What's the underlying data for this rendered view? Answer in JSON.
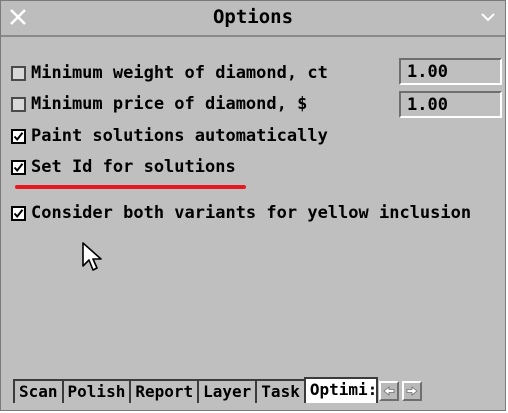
{
  "window": {
    "title": "Options"
  },
  "options": [
    {
      "label": "Minimum weight of diamond, ct",
      "checked": false,
      "value": "1.00"
    },
    {
      "label": "Minimum price of diamond, $",
      "checked": false,
      "value": "1.00"
    },
    {
      "label": "Paint solutions automatically",
      "checked": true
    },
    {
      "label": "Set Id for solutions",
      "checked": true
    },
    {
      "label": "Consider both variants for yellow inclusion",
      "checked": true
    }
  ],
  "tabs": [
    {
      "label": "Scan"
    },
    {
      "label": "Polish"
    },
    {
      "label": "Report"
    },
    {
      "label": "Layer"
    },
    {
      "label": "Task"
    },
    {
      "label": "Optimi:",
      "active": true
    }
  ],
  "icons": {
    "close": "close-icon",
    "menu": "chevron-down-icon",
    "tab_left": "arrow-left-icon",
    "tab_right": "arrow-right-icon",
    "cursor": "mouse-pointer-icon"
  },
  "colors": {
    "window_bg": "#bfbfbf",
    "highlight_underline": "#e5191f"
  }
}
